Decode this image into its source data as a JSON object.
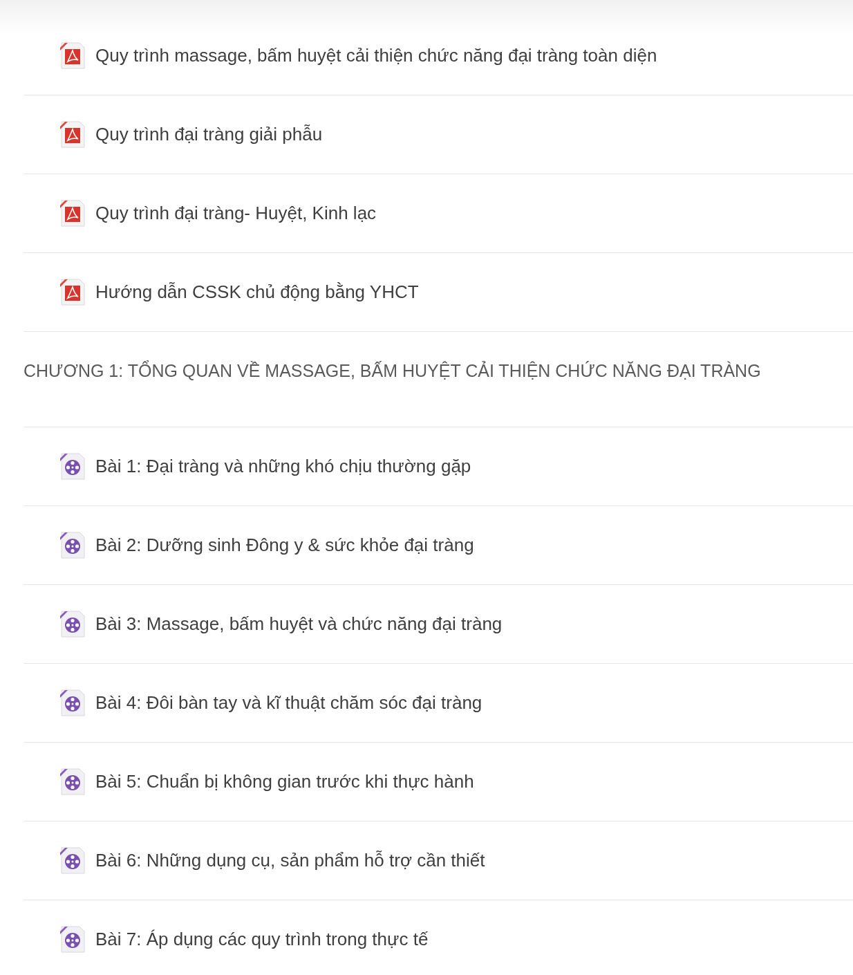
{
  "rows": [
    {
      "kind": "pdf",
      "title": "Quy trình massage, bấm huyệt cải thiện chức năng đại tràng toàn diện"
    },
    {
      "kind": "pdf",
      "title": "Quy trình đại tràng giải phẫu"
    },
    {
      "kind": "pdf",
      "title": "Quy trình đại tràng- Huyệt, Kinh lạc"
    },
    {
      "kind": "pdf",
      "title": "Hướng dẫn CSSK chủ động bằng YHCT"
    },
    {
      "kind": "heading",
      "title": "CHƯƠNG 1: TỔNG QUAN VỀ MASSAGE, BẤM HUYỆT CẢI THIỆN CHỨC NĂNG ĐẠI TRÀNG"
    },
    {
      "kind": "video",
      "title": "Bài 1: Đại tràng và những khó chịu thường gặp"
    },
    {
      "kind": "video",
      "title": "Bài 2: Dưỡng sinh Đông y & sức khỏe đại tràng"
    },
    {
      "kind": "video",
      "title": "Bài 3: Massage, bấm huyệt và chức năng đại tràng"
    },
    {
      "kind": "video",
      "title": "Bài 4: Đôi bàn tay và kĩ thuật chăm sóc đại tràng"
    },
    {
      "kind": "video",
      "title": "Bài 5: Chuẩn bị không gian trước khi thực hành"
    },
    {
      "kind": "video",
      "title": "Bài 6: Những dụng cụ, sản phẩm hỗ trợ cần thiết"
    },
    {
      "kind": "video",
      "title": "Bài 7: Áp dụng các quy trình trong thực tế"
    }
  ]
}
